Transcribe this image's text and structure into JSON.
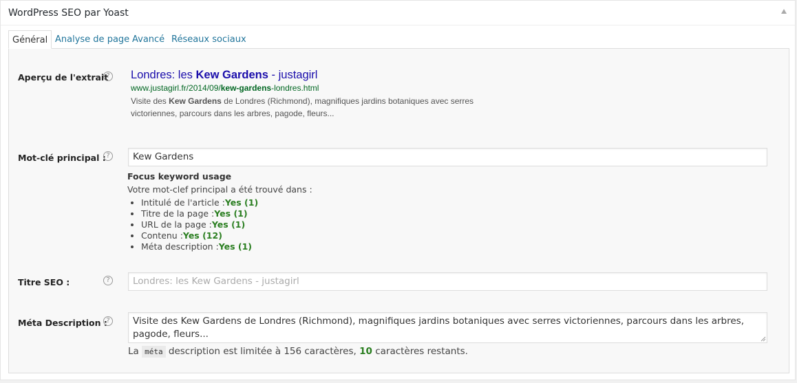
{
  "metabox": {
    "title": "WordPress SEO par Yoast",
    "toggle_icon": "triangle-up-icon"
  },
  "tabs": [
    {
      "label": "Général",
      "active": true
    },
    {
      "label": "Analyse de page",
      "active": false
    },
    {
      "label": "Avancé",
      "active": false
    },
    {
      "label": "Réseaux sociaux",
      "active": false
    }
  ],
  "fields": {
    "snippet_label": "Aperçu de l'extrait",
    "keyword_label": "Mot-clé principal :",
    "seo_title_label": "Titre SEO :",
    "meta_desc_label": "Méta Description :",
    "help_glyph": "?"
  },
  "snippet": {
    "title_pre": "Londres: les ",
    "title_bold": "Kew Gardens",
    "title_post": " - justagirl",
    "url_pre": "www.justagirl.fr/2014/09/",
    "url_bold": "kew-gardens",
    "url_post": "-londres.html",
    "desc_pre": "Visite des ",
    "desc_bold": "Kew Gardens",
    "desc_post": " de Londres (Richmond), magnifiques jardins botaniques avec serres victoriennes, parcours dans les arbres, pagode, fleurs..."
  },
  "keyword": {
    "value": "Kew Gardens",
    "usage_title": "Focus keyword usage",
    "usage_intro": "Votre mot-clef principal a été trouvé dans :",
    "usage_items": [
      {
        "label": "Intitulé de l'article :",
        "result": "Yes (1)"
      },
      {
        "label": "Titre de la page :",
        "result": "Yes (1)"
      },
      {
        "label": "URL de la page :",
        "result": "Yes (1)"
      },
      {
        "label": "Contenu :",
        "result": "Yes (12)"
      },
      {
        "label": "Méta description :",
        "result": "Yes (1)"
      }
    ]
  },
  "seo_title": {
    "placeholder": "Londres: les Kew Gardens  - justagirl"
  },
  "meta_description": {
    "value": "Visite des Kew Gardens de Londres (Richmond), magnifiques jardins botaniques avec serres victoriennes, parcours dans les arbres, pagode, fleurs...",
    "counter_pre": "La",
    "counter_code": "méta",
    "counter_mid": "description est limitée à 156 caractères,",
    "counter_remaining": "10",
    "counter_post": "caractères restants."
  },
  "colors": {
    "link": "#21759b",
    "snippet_title": "#1a0dab",
    "snippet_url": "#006621",
    "good": "#2a7e20"
  }
}
